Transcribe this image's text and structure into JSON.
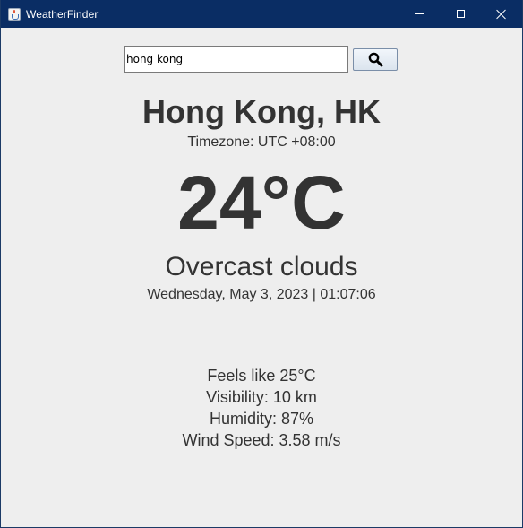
{
  "window": {
    "title": "WeatherFinder"
  },
  "search": {
    "value": "hong kong",
    "button_icon": "search-icon"
  },
  "weather": {
    "location": "Hong Kong, HK",
    "timezone": "Timezone: UTC +08:00",
    "temperature": "24°C",
    "condition": "Overcast clouds",
    "datetime": "Wednesday, May 3, 2023 | 01:07:06"
  },
  "details": {
    "feels_like": "Feels like 25°C",
    "visibility": "Visibility: 10 km",
    "humidity": "Humidity: 87%",
    "wind_speed": "Wind Speed: 3.58 m/s"
  },
  "colors": {
    "titlebar": "#0a2d64",
    "background": "#eeeeee",
    "text": "#333333"
  }
}
